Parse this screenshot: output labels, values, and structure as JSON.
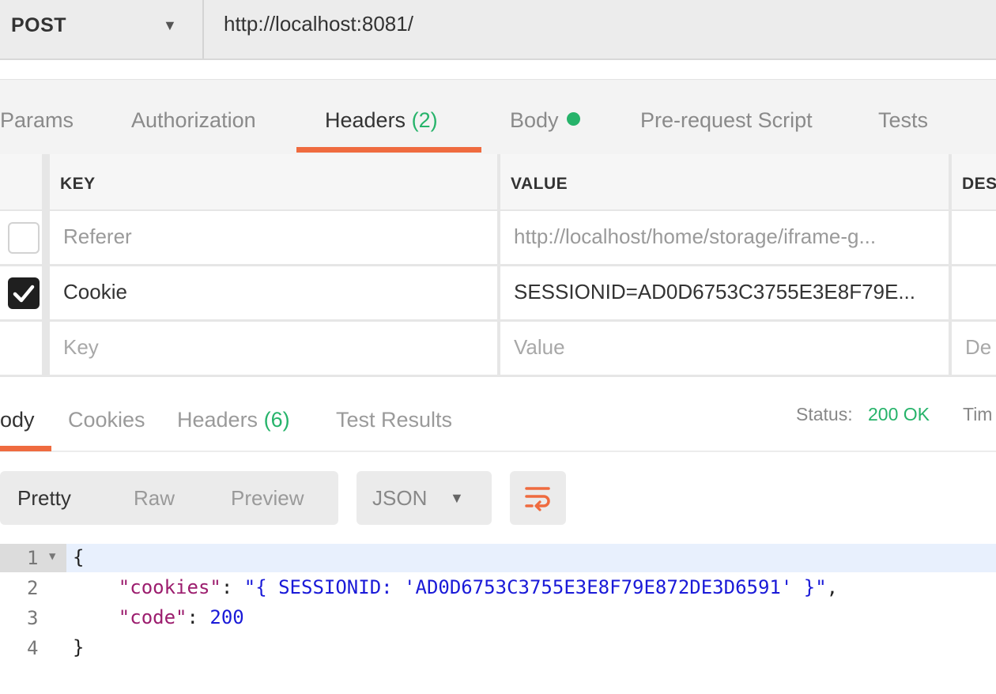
{
  "request": {
    "method": "POST",
    "url": "http://localhost:8081/"
  },
  "request_tabs": {
    "params": "Params",
    "authorization": "Authorization",
    "headers": "Headers",
    "headers_count": "(2)",
    "body": "Body",
    "prerequest": "Pre-request Script",
    "tests": "Tests"
  },
  "headers_table": {
    "columns": {
      "key": "KEY",
      "value": "VALUE",
      "description": "DES"
    },
    "rows": [
      {
        "checked": false,
        "key": "Referer",
        "value": "http://localhost/home/storage/iframe-g..."
      },
      {
        "checked": true,
        "key": "Cookie",
        "value": "SESSIONID=AD0D6753C3755E3E8F79E..."
      }
    ],
    "new_row": {
      "key_placeholder": "Key",
      "value_placeholder": "Value",
      "description_placeholder": "De"
    }
  },
  "response_tabs": {
    "body": "ody",
    "cookies": "Cookies",
    "headers": "Headers",
    "headers_count": "(6)",
    "test_results": "Test Results",
    "status_label": "Status:",
    "status_value": "200 OK",
    "time_label": "Tim"
  },
  "toolbar": {
    "pretty": "Pretty",
    "raw": "Raw",
    "preview": "Preview",
    "format": "JSON",
    "wrap_icon": "wrap-lines-icon"
  },
  "code": {
    "lines": [
      {
        "num": "1",
        "text": "{"
      },
      {
        "num": "2",
        "key": "\"cookies\"",
        "sep": ": ",
        "value": "\"{ SESSIONID: 'AD0D6753C3755E3E8F79E872DE3D6591' }\"",
        "tail": ","
      },
      {
        "num": "3",
        "key": "\"code\"",
        "sep": ": ",
        "value": "200"
      },
      {
        "num": "4",
        "text": "}"
      }
    ]
  },
  "colors": {
    "accent": "#ef6b3f",
    "success": "#26b36a",
    "json_key": "#9c1d6e",
    "json_value": "#1a1ad8"
  }
}
